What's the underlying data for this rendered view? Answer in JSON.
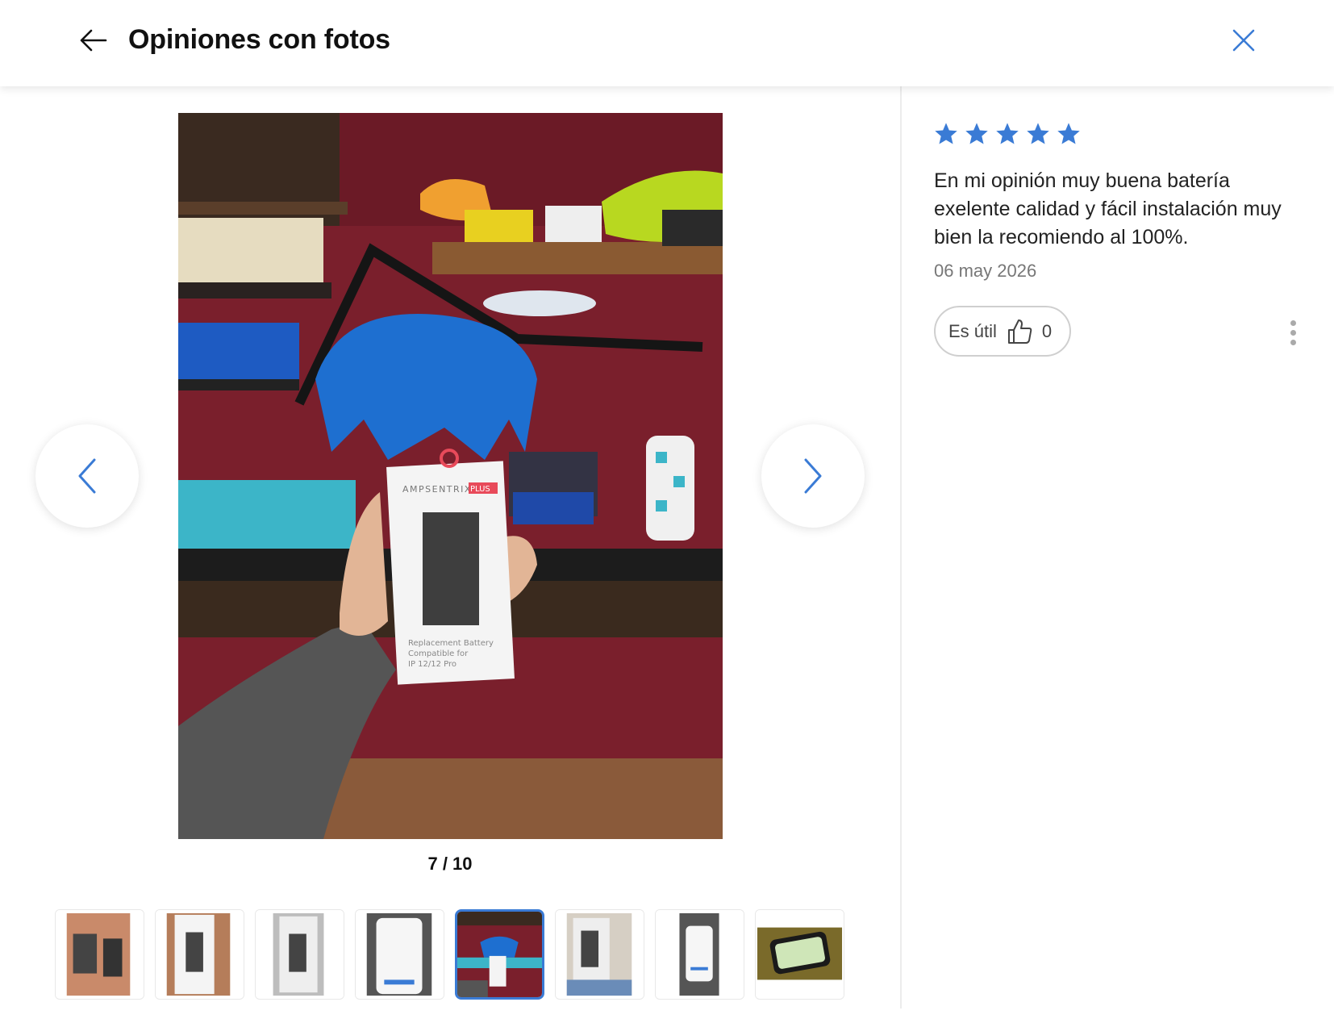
{
  "header": {
    "title": "Opiniones con fotos",
    "back_icon": "arrow-left-icon",
    "close_icon": "close-icon"
  },
  "viewer": {
    "counter": "7 / 10",
    "current_index": 7,
    "total": 10,
    "prev_icon": "chevron-left-icon",
    "next_icon": "chevron-right-icon",
    "product_box": {
      "brand": "AMPSENTRIX",
      "brand_suffix": "PLUS",
      "line1": "Replacement Battery",
      "line2": "Compatible for",
      "line3": "IP 12/12 Pro"
    }
  },
  "thumbnails": {
    "count": 8,
    "active_index": 4
  },
  "review": {
    "rating": 5,
    "max_rating": 5,
    "text": "En mi opinión muy buena batería exelente calidad y fácil instalación muy bien la recomiendo al 100%.",
    "date": "06 may 2026",
    "useful_label": "Es útil",
    "useful_count": "0",
    "more_icon": "more-vertical-icon"
  },
  "colors": {
    "accent": "#3a7bd5",
    "star": "#3a7bd5",
    "wall": "#7a1f2c",
    "mat": "#3cb5c8"
  }
}
